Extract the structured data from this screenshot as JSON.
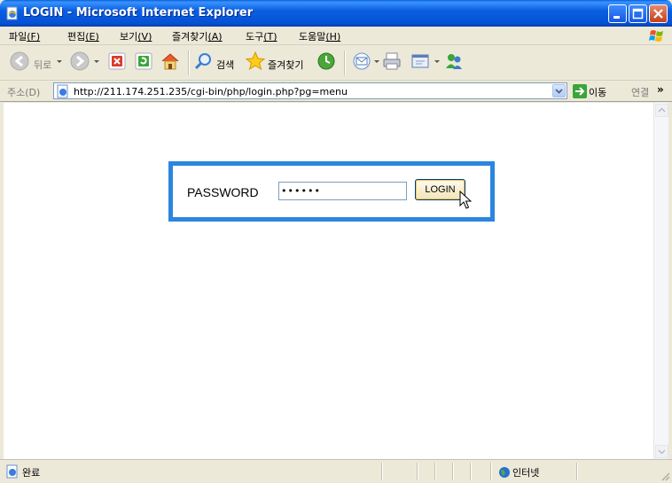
{
  "window": {
    "title": "LOGIN - Microsoft Internet Explorer"
  },
  "menu": [
    {
      "label": "파일",
      "key": "(F)"
    },
    {
      "label": "편집",
      "key": "(E)"
    },
    {
      "label": "보기",
      "key": "(V)"
    },
    {
      "label": "즐겨찾기",
      "key": "(A)"
    },
    {
      "label": "도구",
      "key": "(T)"
    },
    {
      "label": "도움말",
      "key": "(H)"
    }
  ],
  "toolbar": {
    "back_label": "뒤로",
    "search_label": "검색",
    "favorites_label": "즐겨찾기"
  },
  "address": {
    "label": "주소(D)",
    "url": "http://211.174.251.235/cgi-bin/php/login.php?pg=menu",
    "go_label": "이동",
    "links_label": "연결",
    "more": "»"
  },
  "login": {
    "password_label": "PASSWORD",
    "password_value": "••••••",
    "button_label": "LOGIN"
  },
  "status": {
    "text": "완료",
    "zone": "인터넷"
  },
  "colors": {
    "titlebar": "#0a5fe0",
    "login_border": "#2a86df",
    "page_bg": "#ffffff"
  }
}
